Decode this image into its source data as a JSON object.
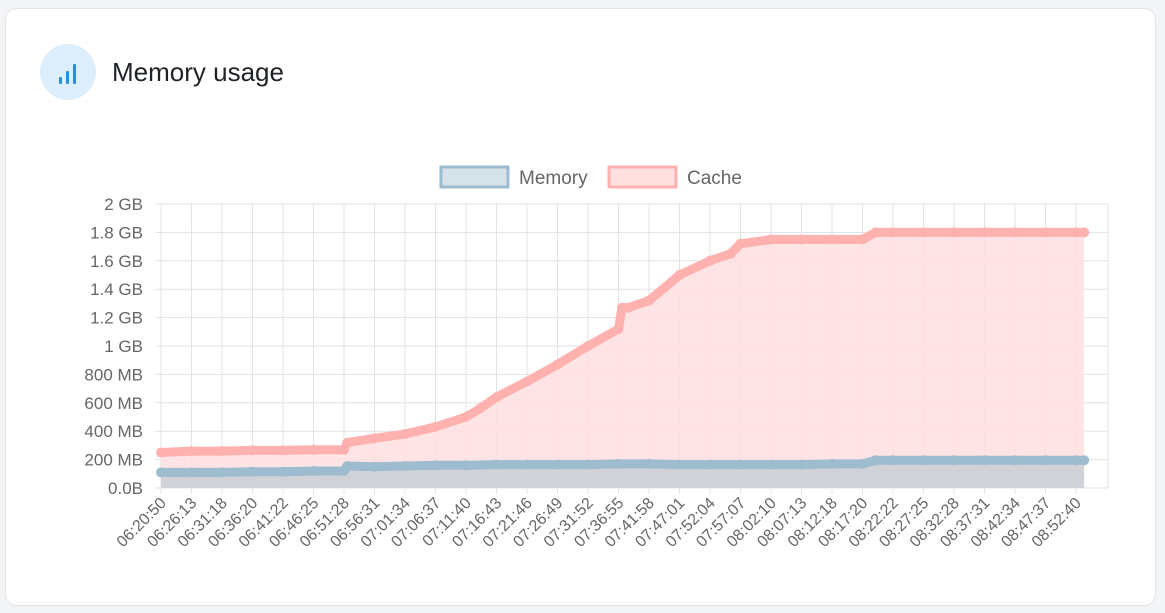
{
  "card": {
    "title": "Memory usage",
    "icon": "bar-chart-icon",
    "icon_color": "#2b8fd6",
    "icon_bg": "#dceefc"
  },
  "chart_data": {
    "type": "area",
    "title": "",
    "xlabel": "",
    "ylabel": "",
    "ylim": [
      0,
      2
    ],
    "y_unit": "GB",
    "y_ticks": [
      "0.0B",
      "200 MB",
      "400 MB",
      "600 MB",
      "800 MB",
      "1 GB",
      "1.2 GB",
      "1.4 GB",
      "1.6 GB",
      "1.8 GB",
      "2 GB"
    ],
    "x_ticks": [
      "06:20:50",
      "06:26:13",
      "06:31:18",
      "06:36:20",
      "06:41:22",
      "06:46:25",
      "06:51:28",
      "06:56:31",
      "07:01:34",
      "07:06:37",
      "07:11:40",
      "07:16:43",
      "07:21:46",
      "07:26:49",
      "07:31:52",
      "07:36:55",
      "07:41:58",
      "07:47:01",
      "07:52:04",
      "07:57:07",
      "08:02:10",
      "08:07:13",
      "08:12:18",
      "08:17:20",
      "08:22:22",
      "08:27:25",
      "08:32:28",
      "08:37:31",
      "08:42:34",
      "08:47:37",
      "08:52:40"
    ],
    "grid": true,
    "legend_position": "top",
    "series": [
      {
        "name": "Memory",
        "color": "#9dbccf",
        "fill": "#d5e2ea",
        "x": [
          "06:20:50",
          "06:26:13",
          "06:31:18",
          "06:36:20",
          "06:41:22",
          "06:46:25",
          "06:51:28",
          "06:52:00",
          "06:56:31",
          "07:01:34",
          "07:06:37",
          "07:11:40",
          "07:16:43",
          "07:21:46",
          "07:26:49",
          "07:31:52",
          "07:36:55",
          "07:41:58",
          "07:47:01",
          "07:52:04",
          "07:57:07",
          "08:02:10",
          "08:07:13",
          "08:12:18",
          "08:17:20",
          "08:19:30",
          "08:22:22",
          "08:27:25",
          "08:32:28",
          "08:37:31",
          "08:42:34",
          "08:47:37",
          "08:52:40",
          "08:54:00"
        ],
        "values": [
          0.11,
          0.11,
          0.11,
          0.115,
          0.115,
          0.12,
          0.12,
          0.155,
          0.15,
          0.155,
          0.16,
          0.16,
          0.165,
          0.165,
          0.165,
          0.165,
          0.17,
          0.17,
          0.165,
          0.165,
          0.165,
          0.165,
          0.165,
          0.17,
          0.17,
          0.195,
          0.195,
          0.195,
          0.195,
          0.195,
          0.195,
          0.195,
          0.195,
          0.195
        ]
      },
      {
        "name": "Cache",
        "color": "#ffb1b0",
        "fill": "#ffdfe0",
        "x": [
          "06:20:50",
          "06:26:13",
          "06:31:18",
          "06:36:20",
          "06:41:22",
          "06:46:25",
          "06:51:28",
          "06:52:00",
          "06:56:31",
          "07:01:34",
          "07:06:37",
          "07:11:40",
          "07:14:00",
          "07:16:43",
          "07:21:46",
          "07:26:49",
          "07:31:52",
          "07:36:55",
          "07:37:30",
          "07:38:30",
          "07:41:58",
          "07:47:01",
          "07:52:04",
          "07:55:30",
          "07:57:07",
          "08:02:10",
          "08:07:13",
          "08:12:18",
          "08:17:20",
          "08:19:30",
          "08:22:22",
          "08:27:25",
          "08:32:28",
          "08:37:31",
          "08:42:34",
          "08:47:37",
          "08:52:40",
          "08:54:00"
        ],
        "values": [
          0.25,
          0.26,
          0.26,
          0.265,
          0.265,
          0.27,
          0.27,
          0.32,
          0.35,
          0.38,
          0.43,
          0.5,
          0.56,
          0.64,
          0.75,
          0.87,
          1.0,
          1.12,
          1.27,
          1.27,
          1.32,
          1.5,
          1.6,
          1.65,
          1.72,
          1.75,
          1.75,
          1.75,
          1.75,
          1.8,
          1.8,
          1.8,
          1.8,
          1.8,
          1.8,
          1.8,
          1.8,
          1.8
        ]
      }
    ]
  }
}
